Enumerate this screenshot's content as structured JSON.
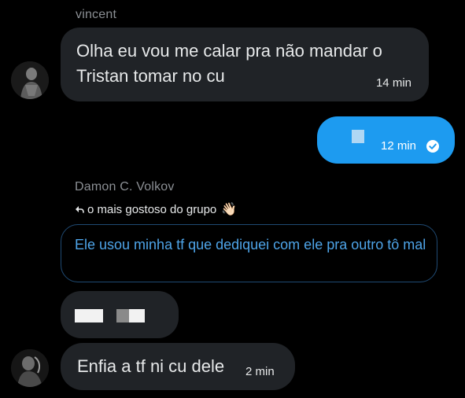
{
  "messages": {
    "msg1": {
      "sender": "vincent",
      "text": "Olha eu vou me calar pra não mandar o Tristan tomar no cu",
      "time": "14 min",
      "avatar_icon": "avatar-photo"
    },
    "msg2": {
      "time": "12 min",
      "status_icon": "check-circle-icon",
      "bubble_color": "#1d9bf0"
    },
    "msg3": {
      "sender": "Damon C. Volkov",
      "reply_prefix": "o mais gostoso do grupo",
      "reply_emoji": "👋🏻",
      "quoted_text": "Ele usou minha tf que dediquei com ele pra outro tô mal"
    },
    "msg4": {
      "content_icon": "redacted-blocks"
    },
    "msg5": {
      "text": "Enfia a tf ni cu dele",
      "time": "2 min",
      "avatar_icon": "avatar-photo"
    }
  },
  "colors": {
    "background": "#000000",
    "incoming_bubble": "#202327",
    "outgoing_bubble": "#1d9bf0",
    "muted_text": "#8b8f94",
    "link_blue": "#4ea4e8"
  }
}
